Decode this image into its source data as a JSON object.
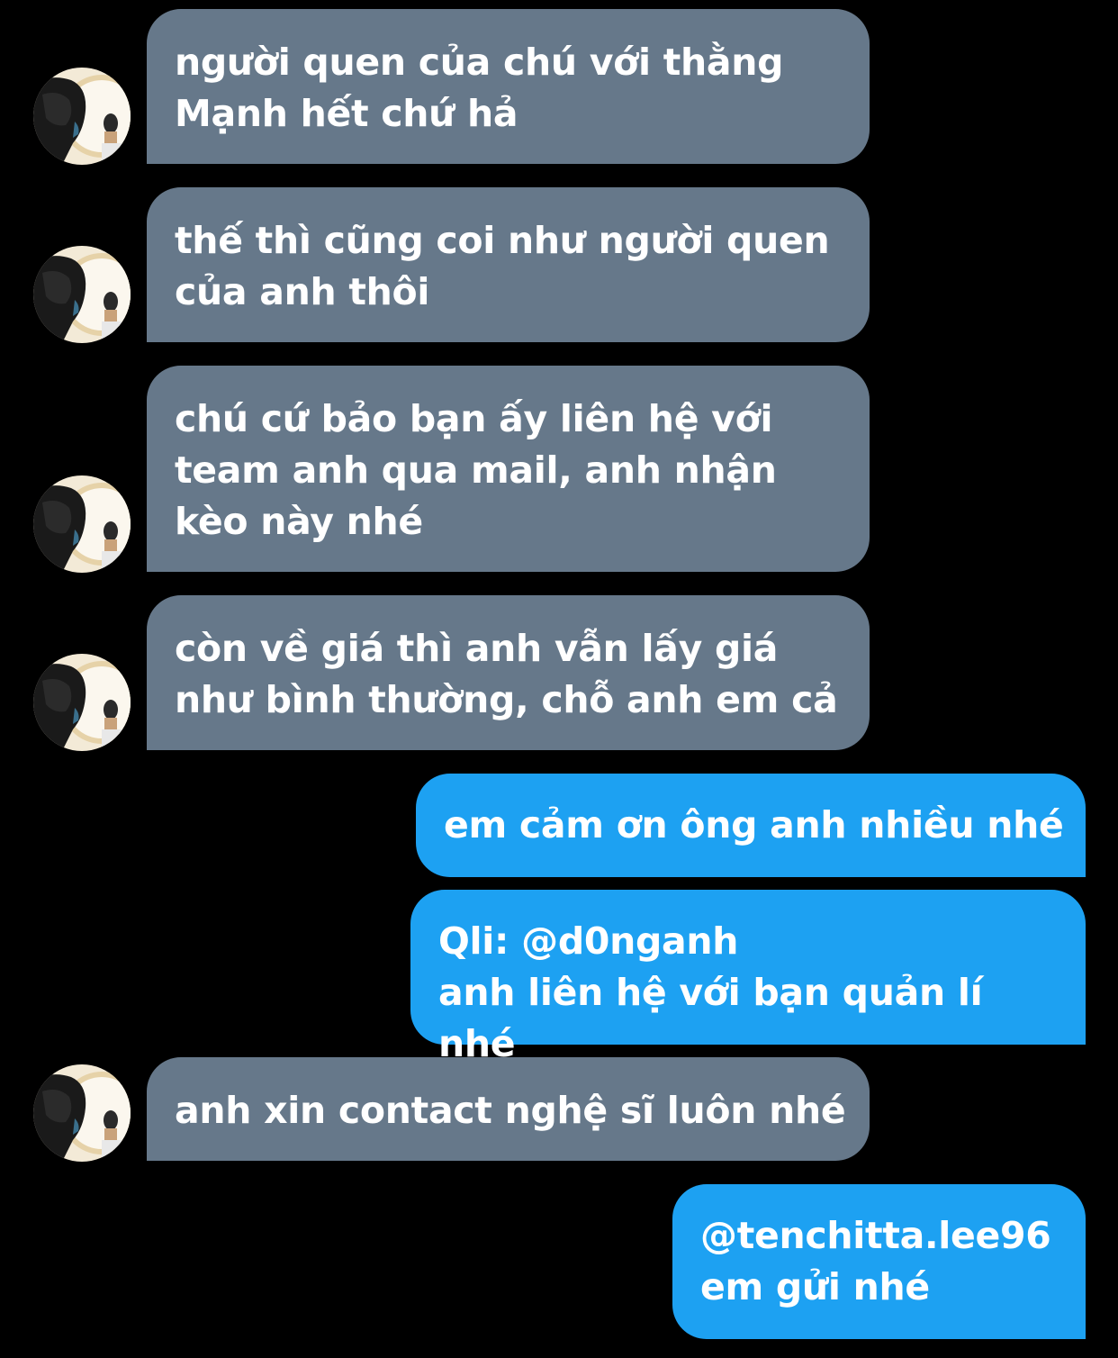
{
  "conversation": {
    "messages": [
      {
        "direction": "incoming",
        "text": "người quen của chú với thằng\nMạnh hết chứ hả"
      },
      {
        "direction": "incoming",
        "text": "thế thì cũng coi như người quen\ncủa anh thôi"
      },
      {
        "direction": "incoming",
        "text": "chú cứ bảo bạn ấy liên hệ với\nteam anh qua mail, anh nhận\nkèo này nhé"
      },
      {
        "direction": "incoming",
        "text": "còn về giá thì anh vẫn lấy giá\nnhư bình thường, chỗ anh em cả"
      },
      {
        "direction": "outgoing",
        "text": "em cảm ơn ông anh nhiều nhé"
      },
      {
        "direction": "outgoing",
        "text": "Qli: @d0nganh\nanh liên hệ với bạn quản lí nhé"
      },
      {
        "direction": "incoming",
        "text": "anh xin contact nghệ sĩ luôn nhé"
      },
      {
        "direction": "outgoing",
        "text": "@tenchitta.lee96\nem gửi nhé"
      }
    ]
  },
  "colors": {
    "background": "#000000",
    "incoming_bubble": "#66788a",
    "outgoing_bubble": "#1da1f2",
    "text": "#ffffff"
  },
  "icons": {
    "avatar": "contact-avatar-photo"
  }
}
